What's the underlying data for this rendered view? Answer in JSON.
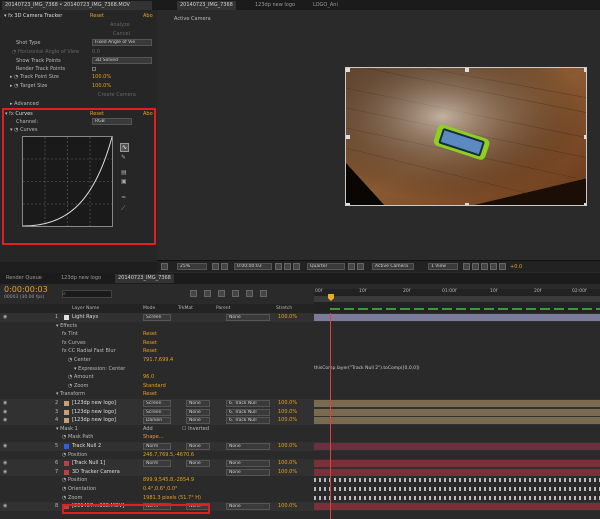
{
  "effects_panel": {
    "tabs": [
      "20140723_IMG_7368 • 20140723_IMG_7368.MOV"
    ],
    "camera_tracker": {
      "name": "3D Camera Tracker",
      "reset": "Reset",
      "about": "Abo"
    },
    "buttons": [
      "Analyze",
      "Cancel",
      "Create Camera"
    ],
    "properties": [
      {
        "label": "Shot Type",
        "value": "Fixed Angle of Vie"
      },
      {
        "label": "Horizontal Angle of View",
        "value": "0.0"
      },
      {
        "label": "Show Track Points",
        "value": "3D Solved"
      },
      {
        "label": "Render Track Points",
        "value": ""
      },
      {
        "label": "Track Point Size",
        "value": "100.0%"
      },
      {
        "label": "Target Size",
        "value": "100.0%"
      },
      {
        "label": "Advanced",
        "value": ""
      }
    ],
    "curves": {
      "name": "Curves",
      "reset": "Reset",
      "about": "Abo",
      "channel_label": "Channel:",
      "channel_value": "RGB",
      "curves_label": "Curves"
    }
  },
  "comp_viewer": {
    "tabs": [
      "20140723_IMG_7368",
      "123dp new logo",
      "LOGO_Ani"
    ],
    "view_label": "Active Camera",
    "zoom": "25%",
    "timecode": "0:00:00:03",
    "resolution": "Quarter",
    "camera": "Active Camera",
    "view": "1 View",
    "exposure": "+0.0"
  },
  "timeline": {
    "tabs": [
      "Render Queue",
      "123dp new logo",
      "20140723_IMG_7368"
    ],
    "timecode": "0:00:00:03",
    "frame_info": "00003 (30.00 fps)",
    "headers": {
      "layer_name": "Layer Name",
      "mode": "Mode",
      "trkmat": "TrkMat",
      "parent": "Parent",
      "stretch": "Stretch"
    },
    "ruler": [
      "00f",
      "10f",
      "20f",
      "01:00f",
      "10f",
      "20f",
      "02:00f"
    ],
    "expression": "thisComp.layer(\"Track Null 2\").toComp([0,0,0])",
    "rows": [
      {
        "num": "1",
        "name": "Light Rays",
        "mode": "Screen",
        "parent": "None",
        "stretch": "100.0%",
        "color": "#e0e0e0",
        "kind": "layer"
      },
      {
        "name": "Effects",
        "kind": "group",
        "indent": 1
      },
      {
        "name": "Tint",
        "value": "Reset",
        "kind": "fx",
        "indent": 2
      },
      {
        "name": "Curves",
        "value": "Reset",
        "kind": "fx",
        "indent": 2
      },
      {
        "name": "CC Radial Fast Blur",
        "value": "Reset",
        "kind": "fx",
        "indent": 2
      },
      {
        "name": "Center",
        "value": "791.7,699.4",
        "kind": "prop",
        "indent": 3
      },
      {
        "name": "Expression: Center",
        "kind": "expr",
        "indent": 4
      },
      {
        "name": "Amount",
        "value": "96.0",
        "kind": "prop",
        "indent": 3
      },
      {
        "name": "Zoom",
        "value": "Standard",
        "kind": "prop",
        "indent": 3
      },
      {
        "name": "Transform",
        "value": "Reset",
        "kind": "group",
        "indent": 1
      },
      {
        "num": "2",
        "name": "[123dp new logo]",
        "mode": "Screen",
        "trk": "None",
        "parent": "6. Track Null",
        "stretch": "100.0%",
        "color": "#c8a070",
        "kind": "layer"
      },
      {
        "num": "3",
        "name": "[123dp new logo]",
        "mode": "Screen",
        "trk": "None",
        "parent": "6. Track Null",
        "stretch": "100.0%",
        "color": "#c8a070",
        "kind": "layer"
      },
      {
        "num": "4",
        "name": "[123dp new logo]",
        "mode": "Darken",
        "trk": "None",
        "parent": "6. Track Null",
        "stretch": "100.0%",
        "color": "#c8a070",
        "kind": "layer"
      },
      {
        "name": "Mask 1",
        "value": "Add",
        "extra": "Inverted",
        "kind": "group",
        "indent": 1
      },
      {
        "name": "Mask Path",
        "value": "Shape...",
        "kind": "prop",
        "indent": 2
      },
      {
        "num": "5",
        "name": "Track Null 2",
        "mode": "Norm",
        "trk": "None",
        "parent": "None",
        "stretch": "100.0%",
        "color": "#3060e0",
        "kind": "layer"
      },
      {
        "name": "Position",
        "value": "246.7,769.5,-4670.6",
        "kind": "prop",
        "indent": 2
      },
      {
        "num": "6",
        "name": "[Track Null 1]",
        "mode": "Norm",
        "trk": "None",
        "parent": "None",
        "stretch": "100.0%",
        "color": "#c04040",
        "kind": "layer"
      },
      {
        "num": "7",
        "name": "3D Tracker Camera",
        "parent": "None",
        "stretch": "100.0%",
        "color": "#c04040",
        "kind": "layer"
      },
      {
        "name": "Position",
        "value": "899.9,545.8,-2854.9",
        "kind": "prop",
        "indent": 2
      },
      {
        "name": "Orientation",
        "value": "0.4°,0.6°,0.0°",
        "kind": "prop",
        "indent": 2
      },
      {
        "name": "Zoom",
        "value": "1981.3 pixels (51.7° H)",
        "kind": "prop",
        "indent": 2
      },
      {
        "num": "8",
        "name": "[201407....368.MOV]",
        "mode": "Norm",
        "trk": "None",
        "parent": "None",
        "stretch": "100.0%",
        "color": "#c04040",
        "kind": "layer"
      }
    ]
  }
}
